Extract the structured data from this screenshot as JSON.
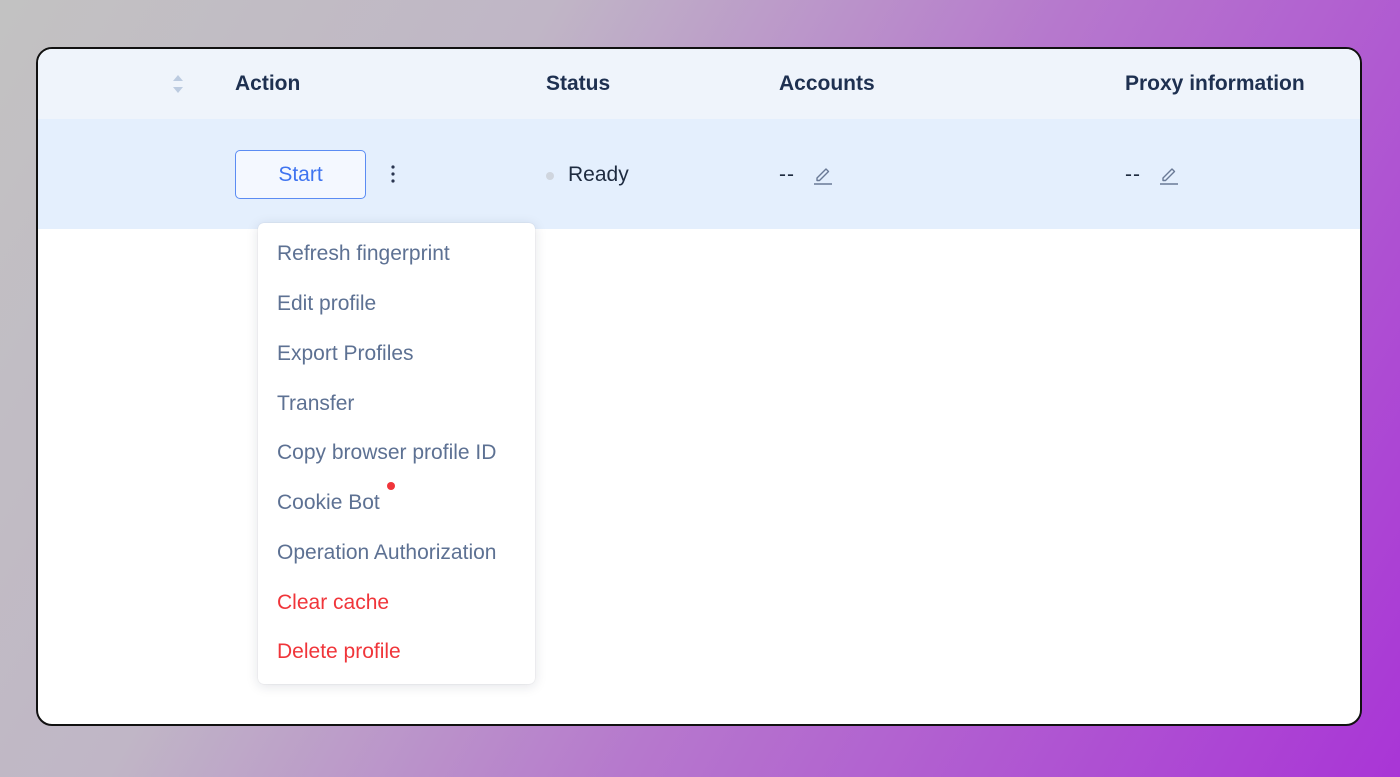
{
  "table": {
    "headers": {
      "action": "Action",
      "status": "Status",
      "accounts": "Accounts",
      "proxy": "Proxy information"
    },
    "row": {
      "start_label": "Start",
      "status": "Ready",
      "accounts": "--",
      "proxy": "--"
    }
  },
  "menu": {
    "items": [
      "Refresh fingerprint",
      "Edit profile",
      "Export Profiles",
      "Transfer",
      "Copy browser profile ID",
      "Cookie Bot",
      "Operation Authorization",
      "Clear cache",
      "Delete profile"
    ]
  },
  "icons": {
    "sort": "sort-icon",
    "more": "more-vertical-icon",
    "edit": "pencil-edit-icon",
    "status": "status-dot-icon",
    "notification": "notification-dot-icon"
  },
  "colors": {
    "accent": "#3f74f0",
    "danger": "#f0353a",
    "header_bg": "#eff4fb",
    "row_bg": "#e4effd",
    "menu_text": "#5d7193"
  }
}
